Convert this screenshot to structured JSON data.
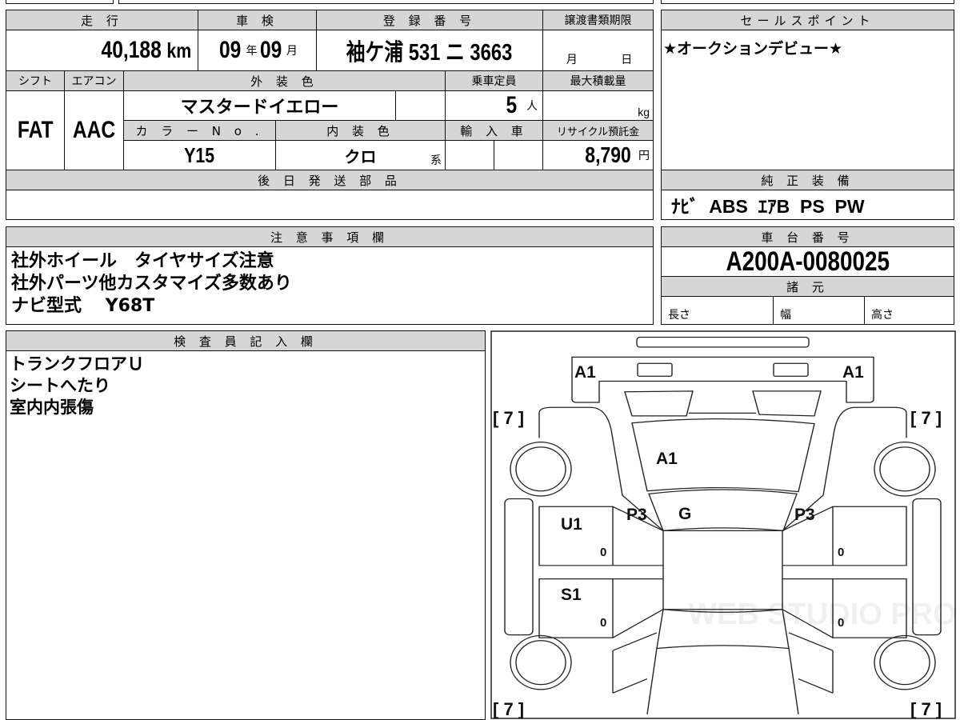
{
  "mileage": {
    "label": "走 行",
    "value": "40,188",
    "unit": "km"
  },
  "inspection": {
    "label": "車 検",
    "year": "09",
    "year_unit": "年",
    "month": "09",
    "month_unit": "月"
  },
  "registration": {
    "label": "登 録 番 号",
    "value": "袖ケ浦 531 ニ 3663"
  },
  "transfer_deadline": {
    "label": "譲渡書類期限",
    "month_unit": "月",
    "day_unit": "日"
  },
  "shift": {
    "label": "シフト",
    "value": "FAT"
  },
  "aircon": {
    "label": "エアコン",
    "value": "AAC"
  },
  "exterior_color": {
    "label": "外 装 色",
    "value": "マスタードイエロー"
  },
  "capacity": {
    "label": "乗車定員",
    "value": "5",
    "unit": "人"
  },
  "max_load": {
    "label": "最大積載量",
    "unit": "kg"
  },
  "color_no": {
    "label": "カ ラ ー N o .",
    "value": "Y15"
  },
  "interior_color": {
    "label": "内 装 色",
    "value": "クロ",
    "suffix": "系"
  },
  "imported": {
    "label": "輸 入 車"
  },
  "recycle_fee": {
    "label": "リサイクル預託金",
    "value": "8,790",
    "unit": "円"
  },
  "parts_later": {
    "label": "後 日 発 送 部 品"
  },
  "sales_point": {
    "label": "セールスポイント",
    "value": "★オークションデビュー★"
  },
  "genuine_equipment": {
    "label": "純 正 装 備",
    "value": "ﾅﾋﾞ  ABS  ｴｱB  PS  PW"
  },
  "notes": {
    "label": "注 意 事 項 欄",
    "lines": [
      "社外ホイール　タイヤサイズ注意",
      "社外パーツ他カスタマイズ多数あり",
      "ナビ型式　 Y68T"
    ]
  },
  "chassis_number": {
    "label": "車 台 番 号",
    "value": "A200A-0080025"
  },
  "specs": {
    "label": "諸 元",
    "length": "長さ",
    "width": "幅",
    "height": "高さ"
  },
  "inspector": {
    "label": "検 査 員 記 入 欄",
    "lines": [
      "トランクフロアＵ",
      "シートへたり",
      "室内内張傷"
    ]
  },
  "diagram": {
    "front_left": "A1",
    "front_right": "A1",
    "hood": "A1",
    "windshield": "G",
    "pillar_left": "P3",
    "pillar_right": "P3",
    "front_door_left": "U1",
    "rear_door_left": "S1",
    "door_marks": [
      "0",
      "0",
      "0",
      "0"
    ],
    "tire_tread": [
      "[ 7 ]",
      "[ 7 ]",
      "[ 7 ]",
      "[ 7 ]"
    ],
    "watermark": "WEB STUDIO PRO"
  }
}
